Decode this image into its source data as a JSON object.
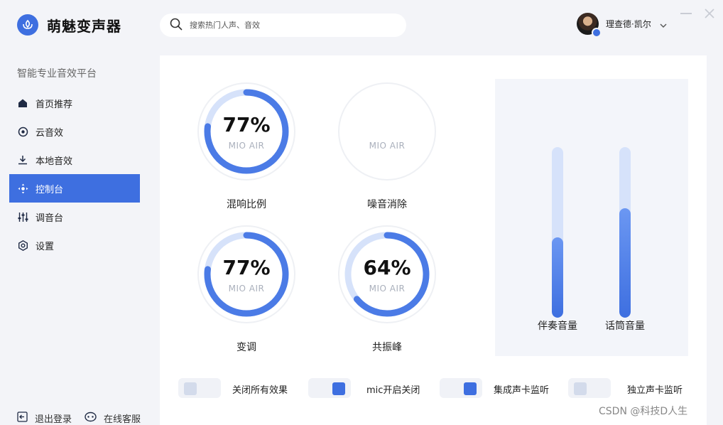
{
  "app": {
    "name": "萌魅变声器",
    "tagline": "智能专业音效平台"
  },
  "search": {
    "placeholder": "搜索热门人声、音效",
    "value": ""
  },
  "user": {
    "name": "理查德·凯尔"
  },
  "sidebar": {
    "items": [
      {
        "label": "首页推荐",
        "icon": "home-icon",
        "active": false
      },
      {
        "label": "云音效",
        "icon": "cloud-sound-icon",
        "active": false
      },
      {
        "label": "本地音效",
        "icon": "download-icon",
        "active": false
      },
      {
        "label": "控制台",
        "icon": "console-icon",
        "active": true
      },
      {
        "label": "调音台",
        "icon": "mixer-icon",
        "active": false
      },
      {
        "label": "设置",
        "icon": "gear-icon",
        "active": false
      }
    ],
    "logout_label": "退出登录",
    "support_label": "在线客服"
  },
  "dials": [
    {
      "label": "混响比例",
      "value": "77%",
      "sub": "MIO AIR",
      "percent": 77
    },
    {
      "label": "噪音消除",
      "value": "",
      "sub": "MIO AIR",
      "percent": 0
    },
    {
      "label": "变调",
      "value": "77%",
      "sub": "MIO AIR",
      "percent": 77
    },
    {
      "label": "共振峰",
      "value": "64%",
      "sub": "MIO AIR",
      "percent": 64
    }
  ],
  "sliders": [
    {
      "label": "伴奏音量",
      "level": 0.47
    },
    {
      "label": "话筒音量",
      "level": 0.64
    }
  ],
  "toggles": [
    {
      "label": "关闭所有效果",
      "on": false
    },
    {
      "label": "mic开启关闭",
      "on": true
    },
    {
      "label": "集成声卡监听",
      "on": true
    },
    {
      "label": "独立声卡监听",
      "on": false
    }
  ],
  "watermark": "CSDN @科技D人生",
  "colors": {
    "accent": "#3e6fe0",
    "accent_light": "#6b97f2",
    "track": "#d6e2fa"
  }
}
